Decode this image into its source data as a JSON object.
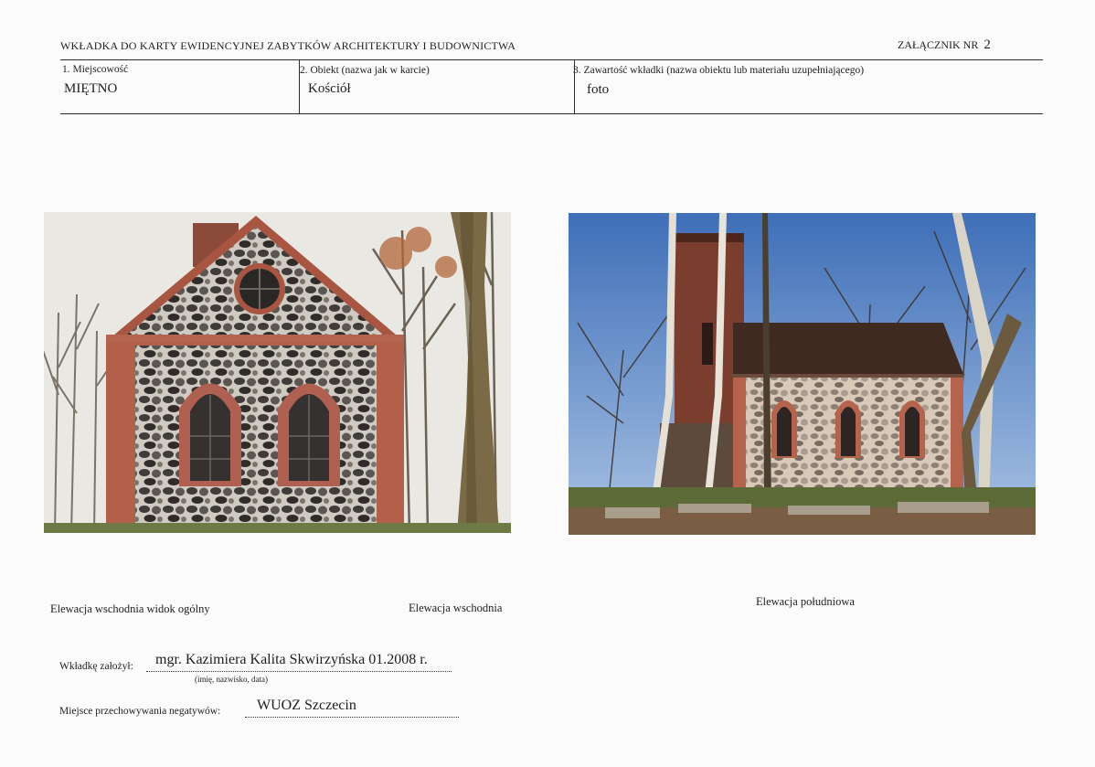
{
  "header": {
    "title": "WKŁADKA DO KARTY EWIDENCYJNEJ ZABYTKÓW ARCHITEKTURY I BUDOWNICTWA",
    "attachment_label": "ZAŁĄCZNIK NR",
    "attachment_number": "2"
  },
  "fields": [
    {
      "label": "1. Miejscowość",
      "value": "MIĘTNO"
    },
    {
      "label": "2. Obiekt (nazwa jak w karcie)",
      "value": "Kościół"
    },
    {
      "label": "3. Zawartość wkładki (nazwa obiektu lub materiału  uzupełniającego)",
      "value": "foto"
    }
  ],
  "photos": [
    {
      "captions": [
        "Elewacja wschodnia widok ogólny",
        "Elewacja wschodnia"
      ]
    },
    {
      "captions": [
        "Elewacja południowa"
      ]
    }
  ],
  "footer": {
    "author_label": "Wkładkę założył:",
    "author_value": "mgr. Kazimiera Kalita Skwirzyńska 01.2008 r.",
    "author_hint": "(imię, nazwisko, data)",
    "storage_label": "Miejsce przechowywania negatywów:",
    "storage_value": "WUOZ Szczecin"
  },
  "colors": {
    "brick": "#a04a38",
    "stone": "#5a5550",
    "sky_left": "#e8e6e0",
    "sky_right": "#5f8cc6"
  }
}
